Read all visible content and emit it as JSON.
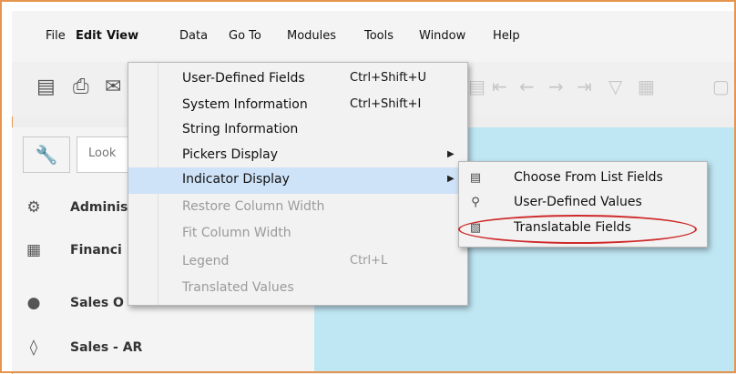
{
  "menubar": {
    "items": [
      "File",
      "Edit",
      "View",
      "Data",
      "Go To",
      "Modules",
      "Tools",
      "Window",
      "Help"
    ]
  },
  "toolbar": {
    "icons": [
      "preview-icon",
      "print-icon",
      "email-icon",
      "filter-icon",
      "first-record-icon",
      "previous-icon",
      "next-icon",
      "last-record-icon",
      "funnel-icon",
      "layout-icon"
    ]
  },
  "sidebar": {
    "search_placeholder": "Look",
    "items": [
      {
        "label": "Adminis",
        "icon": "administration-icon"
      },
      {
        "label": "Financi",
        "icon": "financials-icon"
      },
      {
        "label": "Sales O",
        "icon": "sales-opportunities-icon"
      },
      {
        "label": "Sales - AR",
        "icon": "sales-ar-icon"
      }
    ]
  },
  "view_menu": {
    "items": [
      {
        "label": "User-Defined Fields",
        "shortcut": "Ctrl+Shift+U"
      },
      {
        "label": "System Information",
        "shortcut": "Ctrl+Shift+I"
      },
      {
        "label": "String Information",
        "shortcut": ""
      },
      {
        "label": "Pickers Display",
        "shortcut": ""
      },
      {
        "label": "Indicator Display",
        "shortcut": ""
      },
      {
        "label": "Restore Column Width",
        "shortcut": ""
      },
      {
        "label": "Fit Column Width",
        "shortcut": ""
      },
      {
        "label": "Legend",
        "shortcut": "Ctrl+L"
      },
      {
        "label": "Translated Values",
        "shortcut": ""
      }
    ]
  },
  "indicator_submenu": {
    "items": [
      {
        "label": "Choose From List Fields",
        "icon": "list-icon"
      },
      {
        "label": "User-Defined Values",
        "icon": "search-icon"
      },
      {
        "label": "Translatable Fields",
        "icon": "translate-icon"
      }
    ]
  },
  "colors": {
    "window_border": "#e6954f",
    "menu_highlight": "#cfe3f8",
    "content_bg": "#bfe6f3",
    "annotation": "#cf2a2a"
  }
}
